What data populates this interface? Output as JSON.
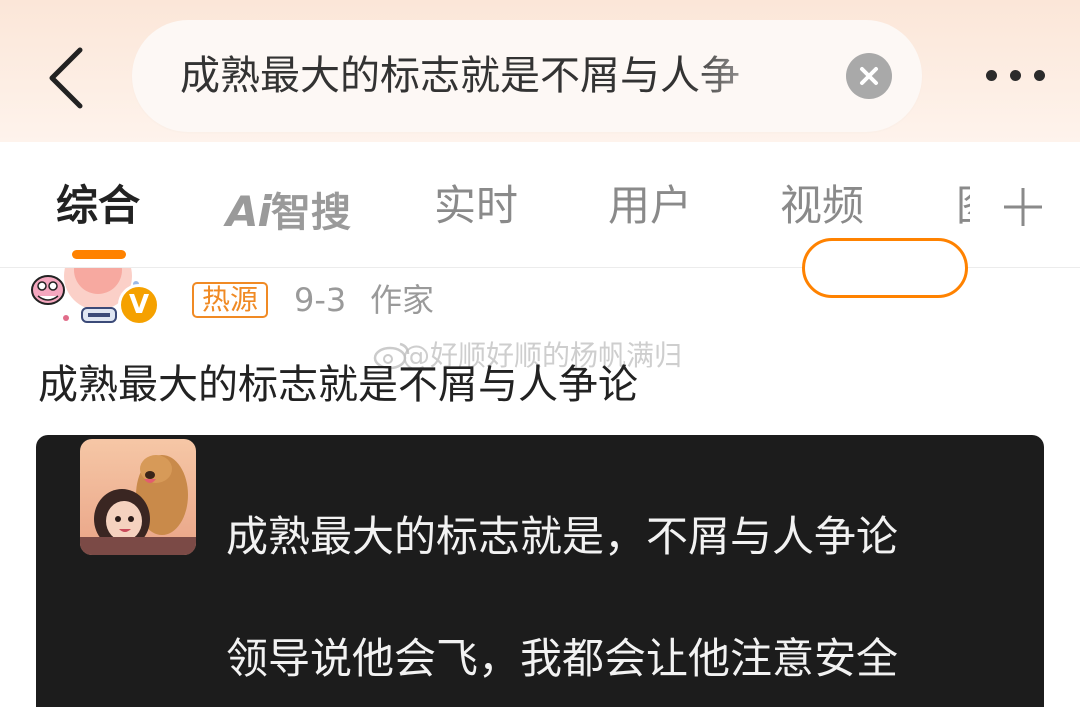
{
  "search": {
    "query": "成熟最大的标志就是不屑与人争"
  },
  "tabs": [
    {
      "label": "综合",
      "active": true
    },
    {
      "label": "Ai",
      "label2": "智搜"
    },
    {
      "label": "实时"
    },
    {
      "label": "用户"
    },
    {
      "label": "视频"
    },
    {
      "label": "图"
    }
  ],
  "post": {
    "badge": "热源",
    "date": "9-3",
    "author_role": "作家",
    "verified_mark": "V",
    "watermark": "@好顺好顺的杨帆满归",
    "text": "成熟最大的标志就是不屑与人争论",
    "image_lines": [
      "成熟最大的标志就是，不屑与人争论",
      "领导说他会飞，我都会让他注意安全"
    ]
  },
  "colors": {
    "accent": "#ff8200",
    "badge": "#f08a24",
    "media_bg": "#1c1c1c"
  }
}
